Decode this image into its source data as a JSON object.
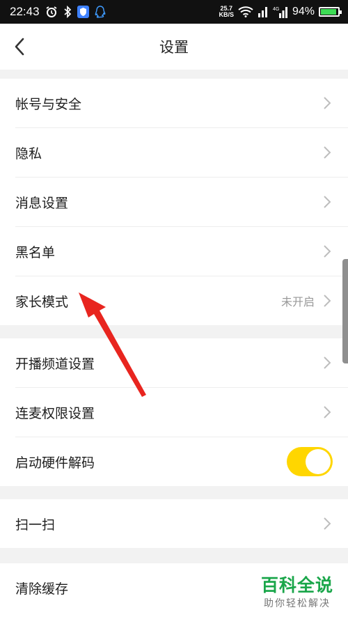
{
  "status_bar": {
    "time": "22:43",
    "net_speed_value": "25.7",
    "net_speed_unit": "KB/S",
    "network_type": "4G",
    "battery_percent": "94%",
    "battery_level": 0.94
  },
  "header": {
    "title": "设置"
  },
  "groups": [
    {
      "items": [
        {
          "label": "帐号与安全"
        },
        {
          "label": "隐私"
        },
        {
          "label": "消息设置"
        },
        {
          "label": "黑名单"
        },
        {
          "label": "家长模式",
          "value": "未开启"
        }
      ]
    },
    {
      "items": [
        {
          "label": "开播频道设置"
        },
        {
          "label": "连麦权限设置"
        },
        {
          "label": "启动硬件解码",
          "toggle_on": true
        }
      ]
    },
    {
      "items": [
        {
          "label": "扫一扫"
        }
      ]
    },
    {
      "items": [
        {
          "label": "清除缓存"
        }
      ]
    }
  ],
  "watermark": {
    "title": "百科全说",
    "subtitle": "助你轻松解决"
  },
  "colors": {
    "accent_toggle": "#ffd600",
    "annotation_arrow": "#e8251f",
    "watermark_green": "#1aa64a"
  }
}
